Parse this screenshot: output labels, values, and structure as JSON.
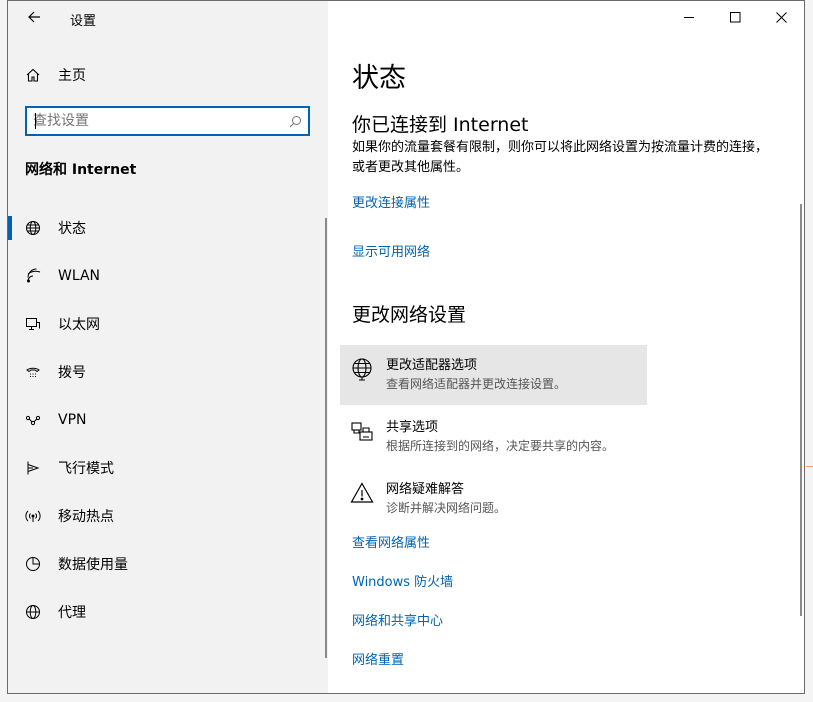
{
  "window": {
    "title": "设置",
    "back_icon": "arrow-left-icon",
    "buttons": [
      "minimize-icon",
      "maximize-icon",
      "close-icon"
    ]
  },
  "sidebar": {
    "home_label": "主页",
    "search": {
      "value": "",
      "placeholder": "查找设置"
    },
    "section_title": "网络和 Internet",
    "items": [
      {
        "label": "状态",
        "icon": "globe-icon",
        "active": true
      },
      {
        "label": "WLAN",
        "icon": "wifi-icon",
        "active": false
      },
      {
        "label": "以太网",
        "icon": "ethernet-icon",
        "active": false
      },
      {
        "label": "拨号",
        "icon": "dialup-icon",
        "active": false
      },
      {
        "label": "VPN",
        "icon": "vpn-icon",
        "active": false
      },
      {
        "label": "飞行模式",
        "icon": "airplane-icon",
        "active": false
      },
      {
        "label": "移动热点",
        "icon": "hotspot-icon",
        "active": false
      },
      {
        "label": "数据使用量",
        "icon": "data-usage-icon",
        "active": false
      },
      {
        "label": "代理",
        "icon": "proxy-globe-icon",
        "active": false
      }
    ]
  },
  "main": {
    "page_title": "状态",
    "connected_heading": "你已连接到 Internet",
    "connected_desc": "如果你的流量套餐有限制，则你可以将此网络设置为按流量计费的连接，或者更改其他属性。",
    "link_change_props": "更改连接属性",
    "link_show_networks": "显示可用网络",
    "change_heading": "更改网络设置",
    "options": [
      {
        "title": "更改适配器选项",
        "subtitle": "查看网络适配器并更改连接设置。",
        "icon": "adapter-globe-icon"
      },
      {
        "title": "共享选项",
        "subtitle": "根据所连接到的网络，决定要共享的内容。",
        "icon": "sharing-printer-icon"
      },
      {
        "title": "网络疑难解答",
        "subtitle": "诊断并解决网络问题。",
        "icon": "warning-triangle-icon"
      }
    ],
    "links": [
      "查看网络属性",
      "Windows 防火墙",
      "网络和共享中心",
      "网络重置"
    ]
  },
  "colors": {
    "accent": "#0063b1",
    "sidebar_bg": "#f2f2f2",
    "hover_bg": "#e6e6e6"
  }
}
